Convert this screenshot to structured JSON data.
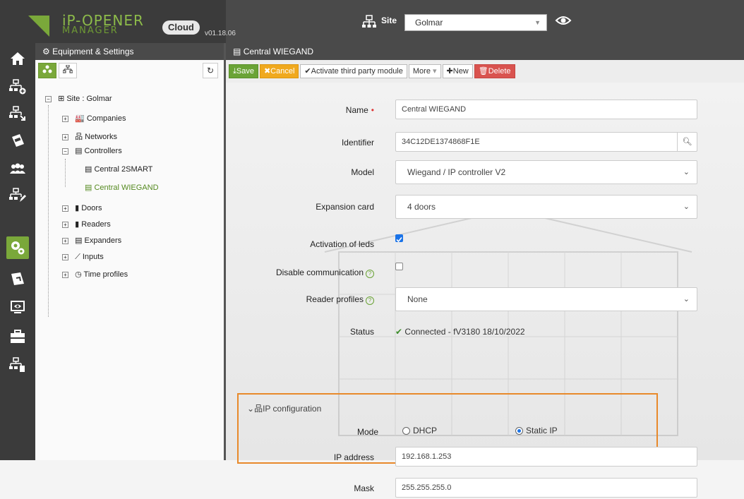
{
  "header": {
    "brand_top": "iP-OPENER",
    "brand_bottom": "MANAGER",
    "cloud_label": "Cloud",
    "version": "v01.18.06",
    "site_label": "Site",
    "site_value": "Golmar"
  },
  "tree_panel": {
    "title": "Equipment & Settings",
    "nodes": {
      "site": "Site : Golmar",
      "companies": "Companies",
      "networks": "Networks",
      "controllers": "Controllers",
      "central_2smart": "Central 2SMART",
      "central_wiegand": "Central WIEGAND",
      "doors": "Doors",
      "readers": "Readers",
      "expanders": "Expanders",
      "inputs": "Inputs",
      "time_profiles": "Time profiles"
    }
  },
  "main": {
    "title": "Central WIEGAND",
    "toolbar": {
      "save": "Save",
      "cancel": "Cancel",
      "activate": "Activate third party module",
      "more": "More",
      "new": "New",
      "delete": "Delete"
    },
    "form": {
      "name_label": "Name",
      "name_value": "Central WIEGAND",
      "identifier_label": "Identifier",
      "identifier_value": "34C12DE1374868F1E",
      "model_label": "Model",
      "model_value": "Wiegand / IP controller V2",
      "expansion_label": "Expansion card",
      "expansion_value": "4 doors",
      "leds_label": "Activation of leds",
      "leds_checked": true,
      "disable_comm_label": "Disable communication",
      "disable_comm_checked": false,
      "reader_profiles_label": "Reader profiles",
      "reader_profiles_value": "None",
      "status_label": "Status",
      "status_value": "Connected - fV3180 18/10/2022",
      "ip_section": "IP configuration",
      "mode_label": "Mode",
      "mode_dhcp": "DHCP",
      "mode_static": "Static IP",
      "mode_selected": "Static IP",
      "ip_label": "IP address",
      "ip_value": "192.168.1.253",
      "mask_label": "Mask",
      "mask_value": "255.255.255.0"
    }
  },
  "colors": {
    "accent_green": "#7aa83a",
    "cancel_orange": "#f0a91e",
    "delete_red": "#d9534f",
    "highlight_box": "#e8892a"
  }
}
